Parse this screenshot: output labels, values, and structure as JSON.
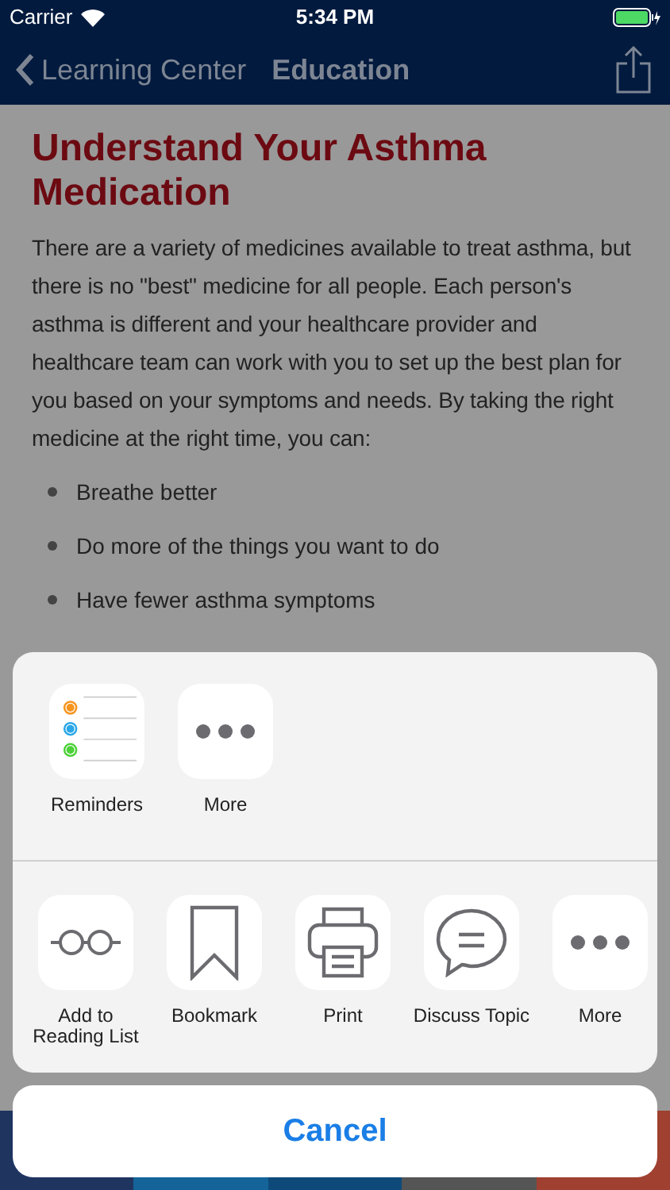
{
  "status_bar": {
    "carrier": "Carrier",
    "time": "5:34 PM"
  },
  "nav": {
    "back": "Learning Center",
    "title": "Education"
  },
  "article": {
    "heading": "Understand Your Asthma Medication",
    "body": "There are a variety of medicines available to treat asthma, but there is no \"best\" medicine for all people. Each person's asthma is different and your healthcare provider and healthcare team can work with you to set up the best plan for you based on your symptoms and needs. By taking the right medicine at the right time, you can:",
    "bullets": [
      "Breathe better",
      "Do more of the things you want to do",
      "Have fewer asthma symptoms"
    ]
  },
  "tab_bar": [
    {
      "color": "#1f3560"
    },
    {
      "color": "#14649a"
    },
    {
      "color": "#0d4a7a"
    },
    {
      "color": "#555555"
    },
    {
      "color": "#a04030"
    }
  ],
  "share_sheet": {
    "apps": [
      {
        "kind": "reminders",
        "label": "Reminders"
      },
      {
        "kind": "more",
        "label": "More"
      }
    ],
    "actions": [
      {
        "kind": "glasses",
        "label": "Add to Reading List"
      },
      {
        "kind": "bookmark",
        "label": "Bookmark"
      },
      {
        "kind": "print",
        "label": "Print"
      },
      {
        "kind": "chat",
        "label": "Discuss Topic"
      },
      {
        "kind": "more",
        "label": "More"
      }
    ],
    "cancel": "Cancel"
  }
}
